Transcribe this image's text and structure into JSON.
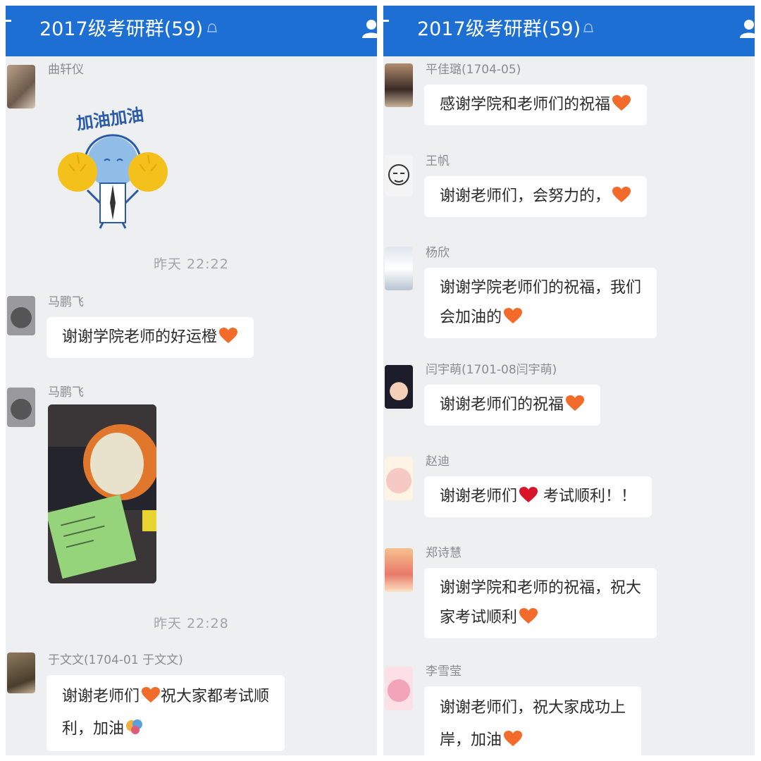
{
  "left": {
    "title": "2017级考研群(59)",
    "messages": [
      {
        "sender": "曲轩仪",
        "sticker_text": "加油加油"
      },
      {
        "sender": "马鹏飞",
        "text": "谢谢学院老师的好运橙"
      },
      {
        "sender": "马鹏飞",
        "image": "orange-with-note-photo"
      },
      {
        "sender": "于文文(1704-01 于文文)",
        "text1": "谢谢老师们",
        "text2": "祝大家都考试顺",
        "text3": "利，加油"
      }
    ],
    "times": [
      "昨天  22:22",
      "昨天  22:28"
    ]
  },
  "right": {
    "title": "2017级考研群(59)",
    "messages": [
      {
        "sender": "平佳璐(1704-05)",
        "text": "感谢学院和老师们的祝福"
      },
      {
        "sender": "王帆",
        "text": "谢谢老师们，会努力的，"
      },
      {
        "sender": "杨欣",
        "line1": "谢谢学院老师们的祝福，我们",
        "line2": "会加油的"
      },
      {
        "sender": "闫宇萌(1701-08闫宇萌)",
        "text": "谢谢老师们的祝福"
      },
      {
        "sender": "赵迪",
        "text_a": "谢谢老师们",
        "text_b": " 考试顺利！！"
      },
      {
        "sender": "郑诗慧",
        "line1": "谢谢学院和老师的祝福，祝大",
        "line2": "家考试顺利"
      },
      {
        "sender": "李雪莹",
        "line1": "谢谢老师们，祝大家成功上",
        "line2": "岸，加油"
      }
    ]
  },
  "colors": {
    "header": "#1e6fd4",
    "background": "#eeeff1",
    "bubble": "#ffffff",
    "heart_orange": "#f26b2a",
    "heart_red": "#d8142a"
  },
  "icons": [
    "back-icon",
    "group-member-icon",
    "mute-icon",
    "orange-heart-emoji",
    "red-heart-emoji",
    "cheer-sticker"
  ]
}
